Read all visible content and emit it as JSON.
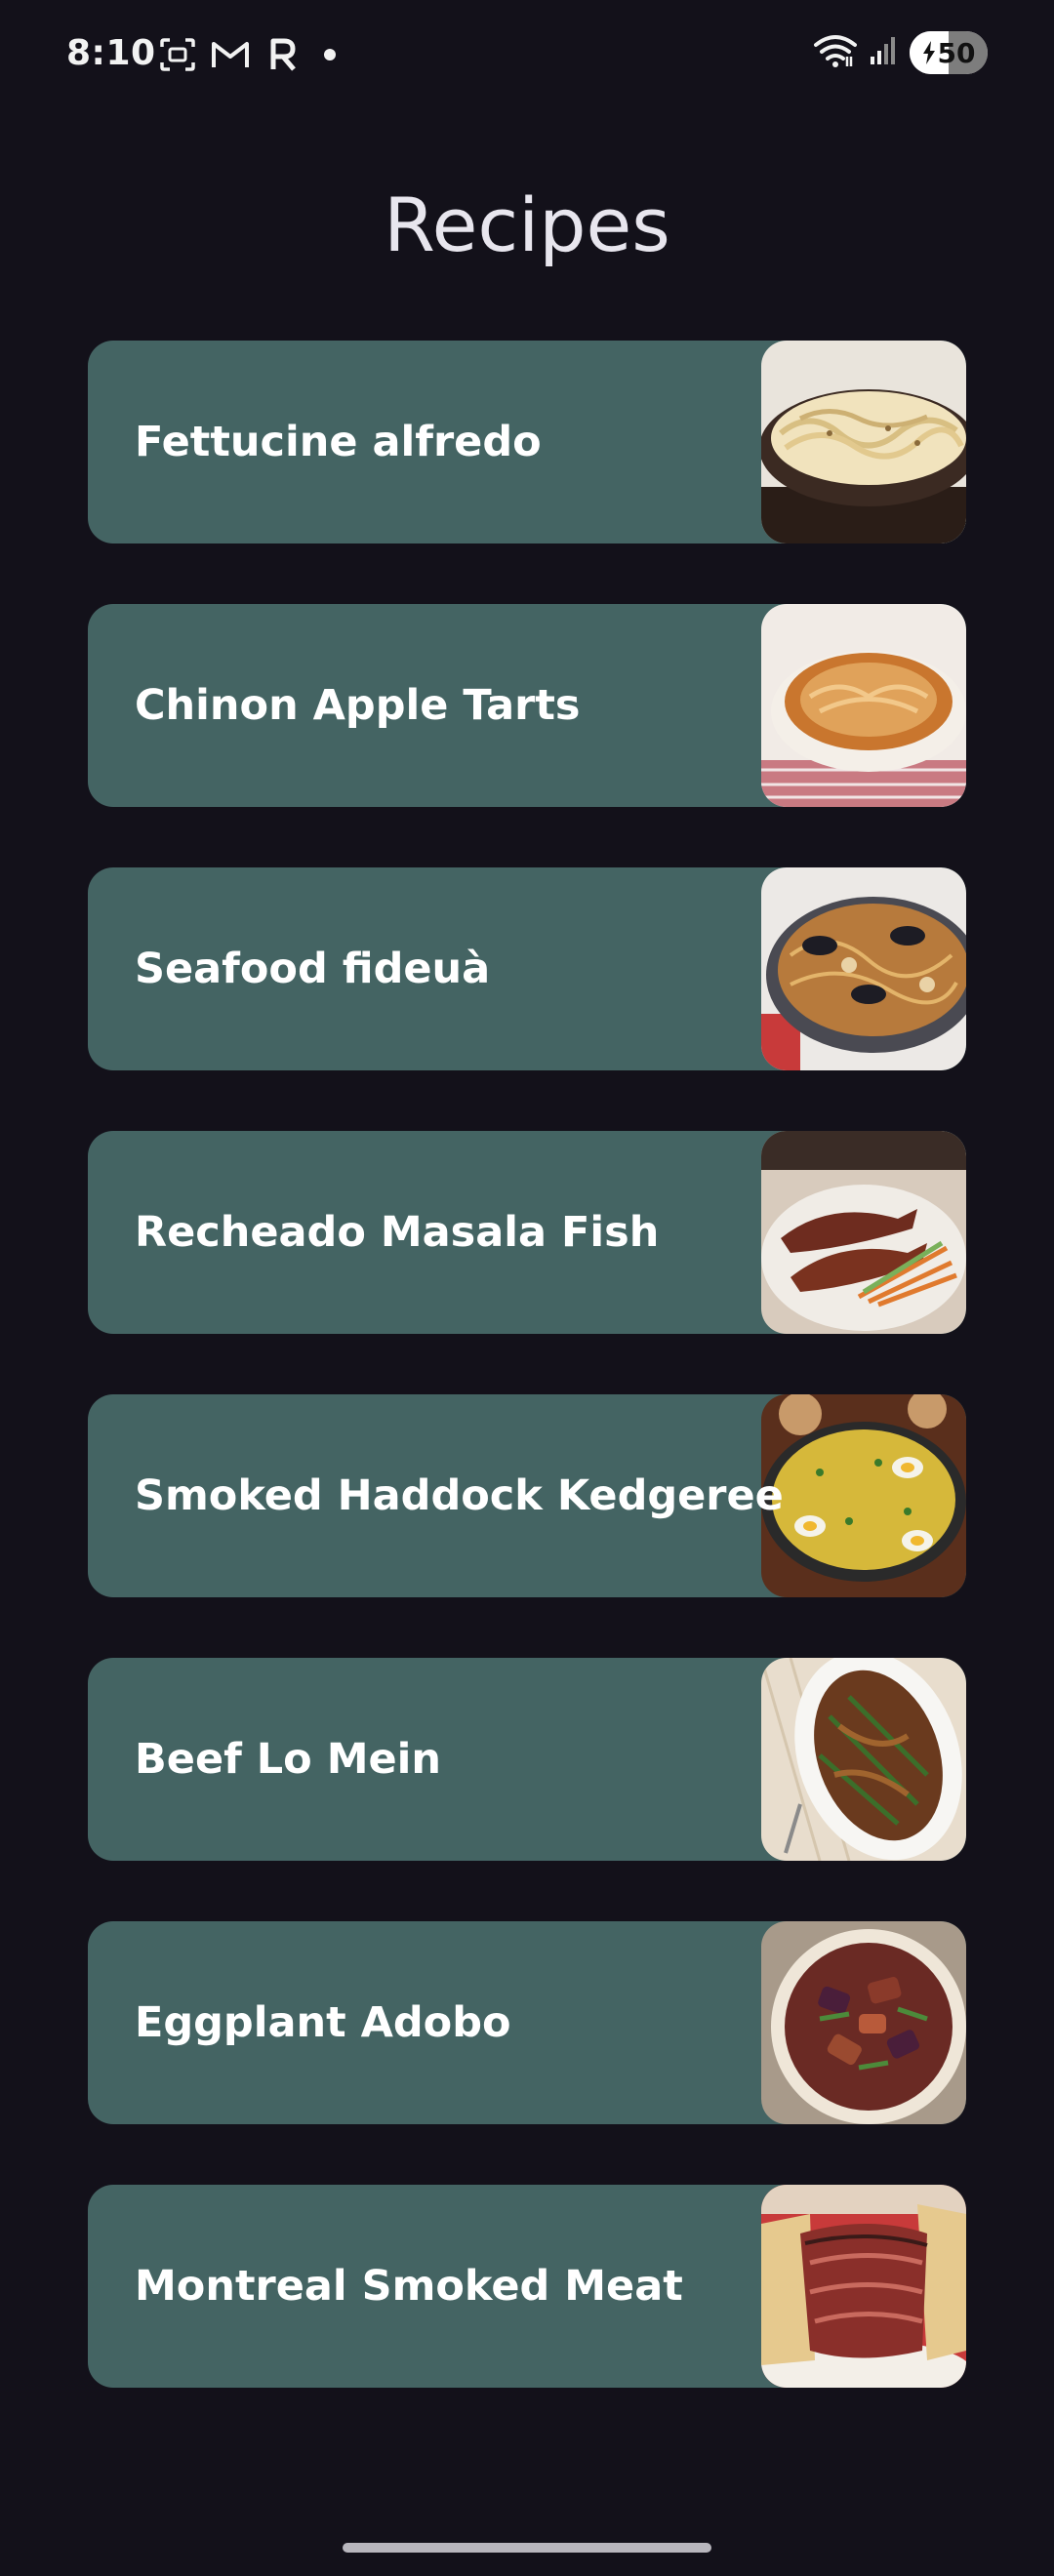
{
  "status_bar": {
    "time": "8:10",
    "battery_level": "50",
    "battery_fraction": 0.5,
    "left_icons": [
      "screenshot-icon",
      "gmail-icon",
      "r-app-icon",
      "notification-dot"
    ],
    "right_icons": [
      "wifi-icon",
      "signal-icon",
      "battery-icon"
    ]
  },
  "page": {
    "title": "Recipes"
  },
  "recipes": [
    {
      "name": "Fettucine alfredo",
      "thumb": "fettucine-alfredo-image"
    },
    {
      "name": "Chinon Apple Tarts",
      "thumb": "apple-tart-image"
    },
    {
      "name": "Seafood fideuà",
      "thumb": "seafood-fideua-image"
    },
    {
      "name": "Recheado Masala Fish",
      "thumb": "masala-fish-image"
    },
    {
      "name": "Smoked Haddock Kedgeree",
      "thumb": "kedgeree-image"
    },
    {
      "name": "Beef Lo Mein",
      "thumb": "beef-lo-mein-image"
    },
    {
      "name": "Eggplant Adobo",
      "thumb": "eggplant-adobo-image"
    },
    {
      "name": "Montreal Smoked Meat",
      "thumb": "smoked-meat-image"
    }
  ],
  "colors": {
    "background": "#13111a",
    "card": "#446463",
    "text": "#ffffff"
  }
}
